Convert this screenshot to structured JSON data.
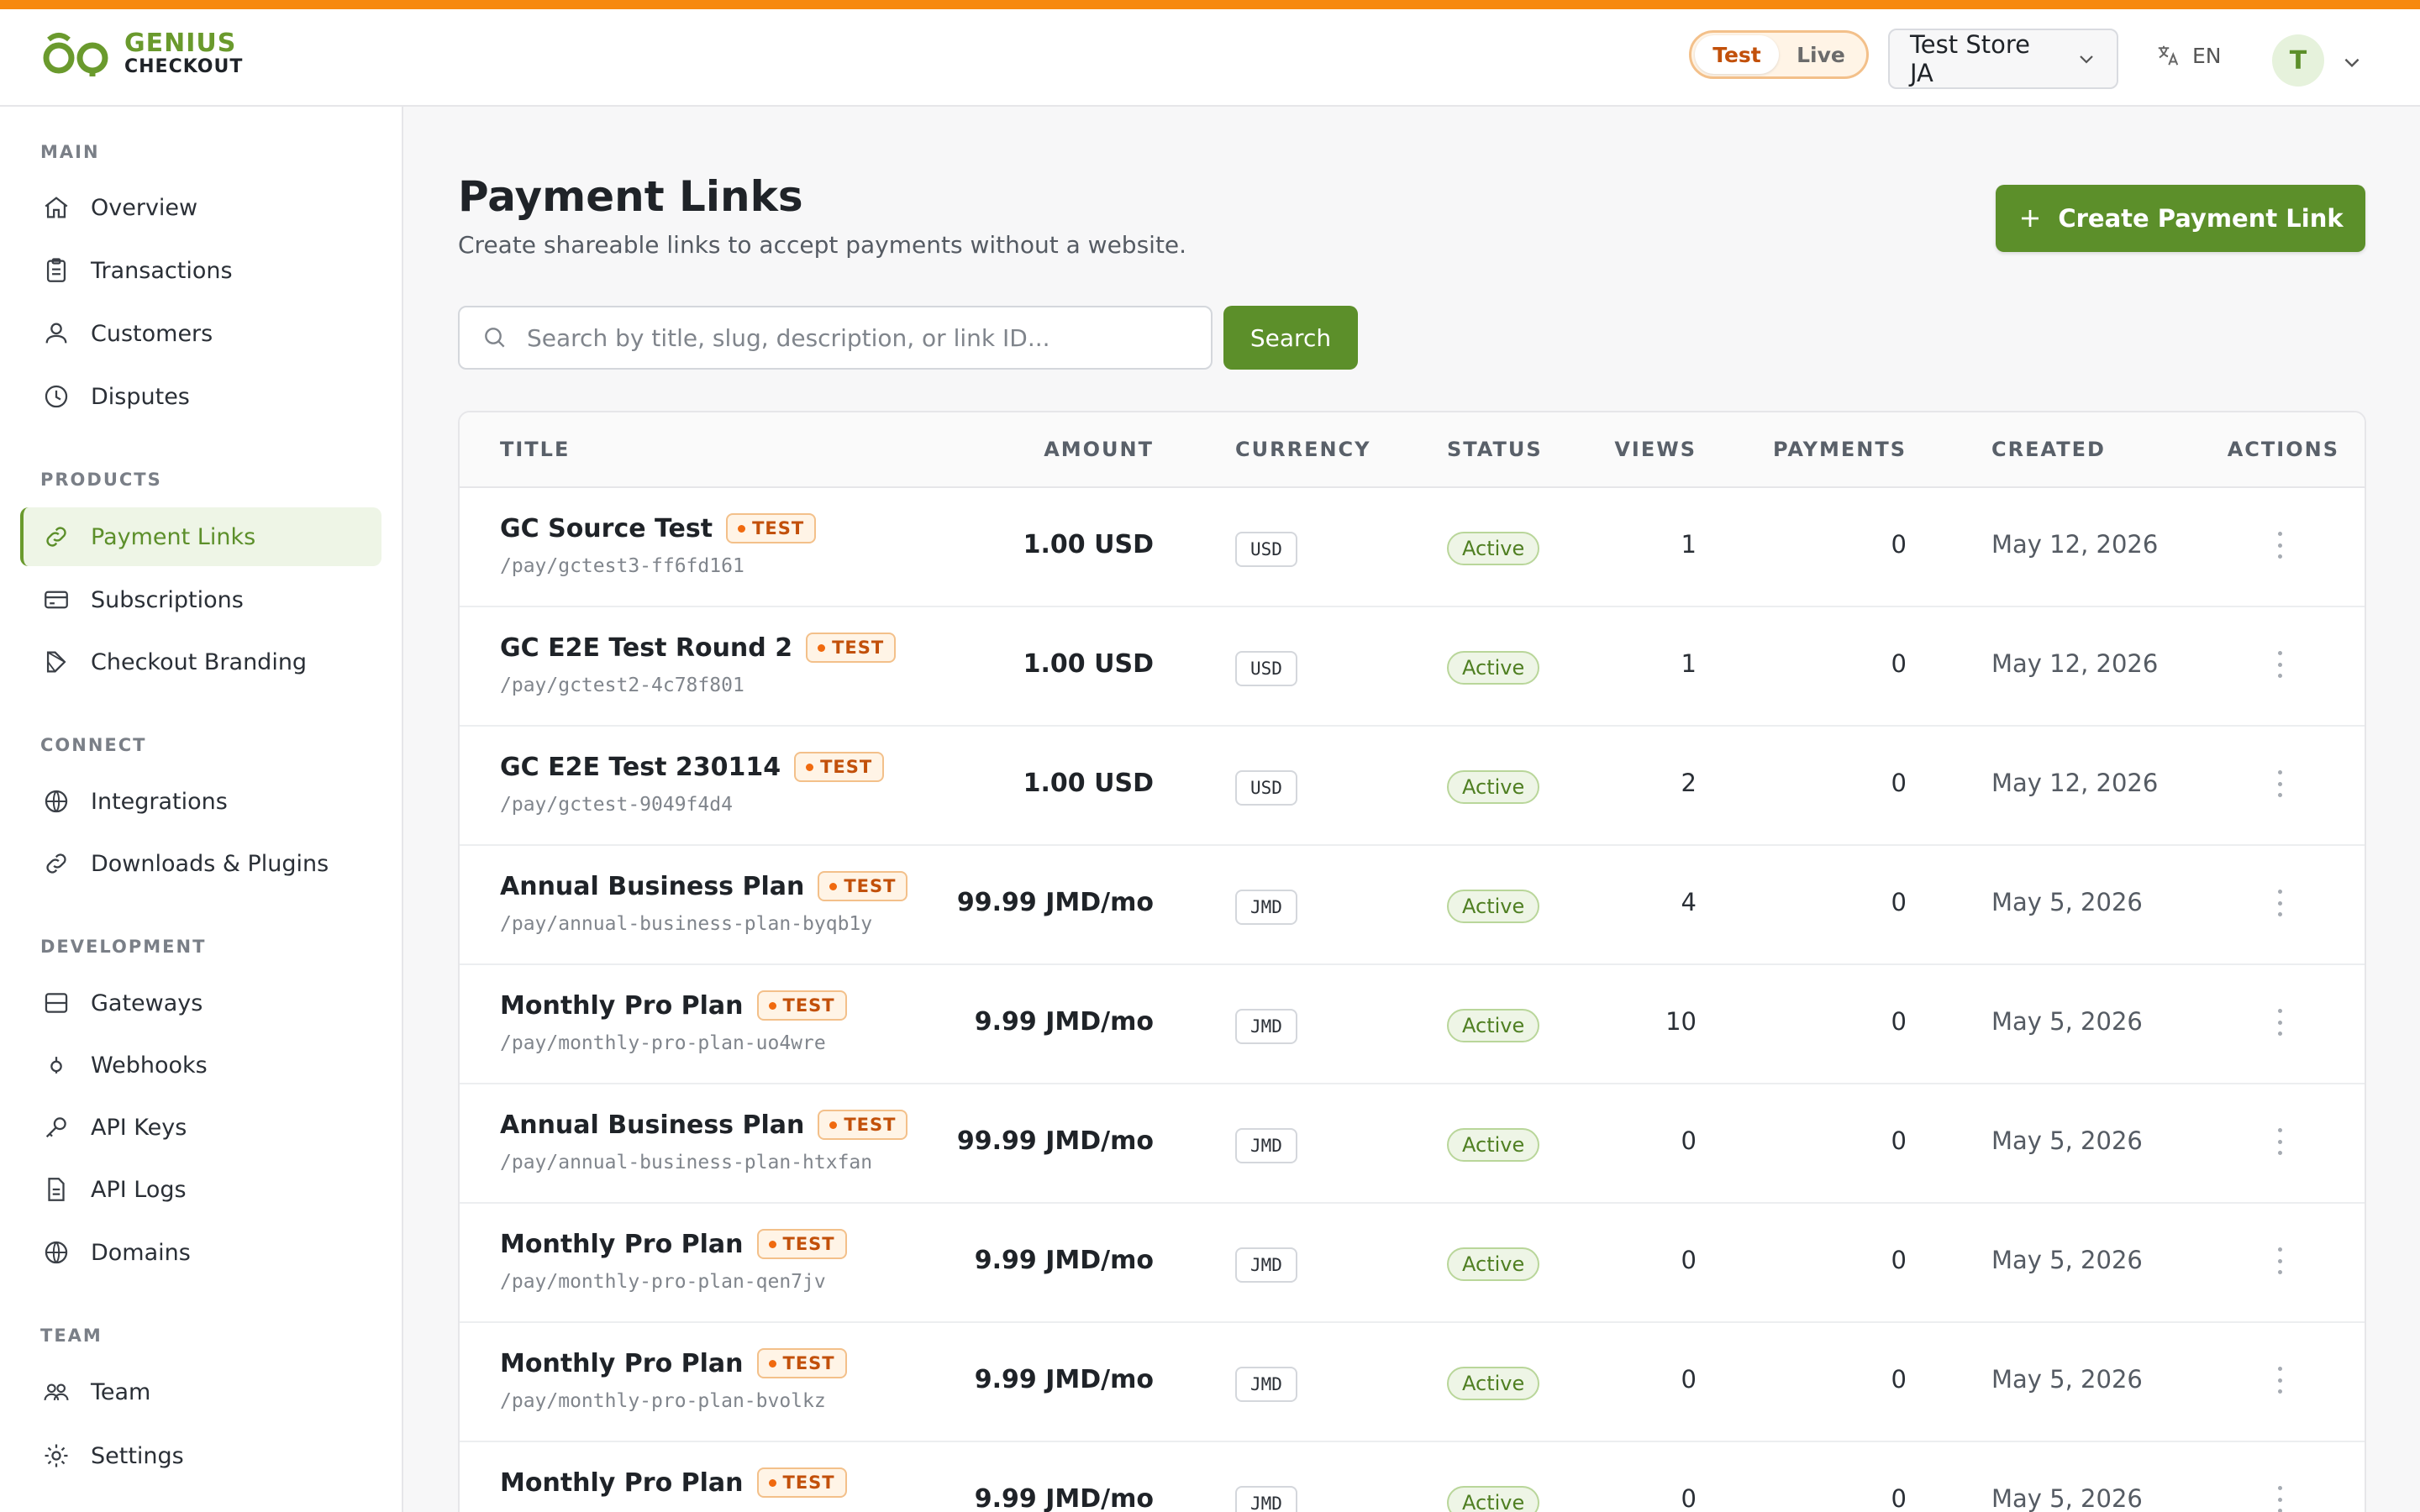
{
  "brand": {
    "line1": "GENIUS",
    "line2": "CHECKOUT",
    "accent": "#f7890f",
    "green": "#5c8f2a"
  },
  "topnav": {
    "mode_test": "Test",
    "mode_live": "Live",
    "store": "Test Store JA",
    "lang": "EN",
    "avatar": "T"
  },
  "sidebar": {
    "sections": [
      {
        "label": "MAIN",
        "items": [
          {
            "label": "Overview",
            "icon": "home-icon"
          },
          {
            "label": "Transactions",
            "icon": "clipboard-icon"
          },
          {
            "label": "Customers",
            "icon": "users-icon"
          },
          {
            "label": "Disputes",
            "icon": "clock-icon"
          }
        ]
      },
      {
        "label": "PRODUCTS",
        "items": [
          {
            "label": "Payment Links",
            "icon": "link-icon",
            "active": true
          },
          {
            "label": "Subscriptions",
            "icon": "credit-card-icon"
          },
          {
            "label": "Checkout Branding",
            "icon": "palette-icon"
          }
        ]
      },
      {
        "label": "CONNECT",
        "items": [
          {
            "label": "Integrations",
            "icon": "globe-icon"
          },
          {
            "label": "Downloads & Plugins",
            "icon": "link-icon"
          }
        ]
      },
      {
        "label": "DEVELOPMENT",
        "items": [
          {
            "label": "Gateways",
            "icon": "server-icon"
          },
          {
            "label": "Webhooks",
            "icon": "webhook-icon"
          },
          {
            "label": "API Keys",
            "icon": "key-icon"
          },
          {
            "label": "API Logs",
            "icon": "file-icon"
          },
          {
            "label": "Domains",
            "icon": "globe-icon"
          }
        ]
      },
      {
        "label": "TEAM",
        "items": [
          {
            "label": "Team",
            "icon": "team-icon"
          },
          {
            "label": "Settings",
            "icon": "gear-icon"
          }
        ]
      }
    ]
  },
  "page": {
    "title": "Payment Links",
    "subtitle": "Create shareable links to accept payments without a website.",
    "create_label": "Create Payment Link",
    "search_placeholder": "Search by title, slug, description, or link ID...",
    "search_label": "Search"
  },
  "table": {
    "headers": {
      "title": "TITLE",
      "amount": "AMOUNT",
      "currency": "CURRENCY",
      "status": "STATUS",
      "views": "VIEWS",
      "payments": "PAYMENTS",
      "created": "CREATED",
      "actions": "ACTIONS"
    },
    "badge_test": "TEST",
    "rows": [
      {
        "title": "GC Source Test",
        "slug": "/pay/gctest3-ff6fd161",
        "amount": "1.00 USD",
        "currency": "USD",
        "status": "Active",
        "views": "1",
        "payments": "0",
        "created": "May 12, 2026"
      },
      {
        "title": "GC E2E Test Round 2",
        "slug": "/pay/gctest2-4c78f801",
        "amount": "1.00 USD",
        "currency": "USD",
        "status": "Active",
        "views": "1",
        "payments": "0",
        "created": "May 12, 2026"
      },
      {
        "title": "GC E2E Test 230114",
        "slug": "/pay/gctest-9049f4d4",
        "amount": "1.00 USD",
        "currency": "USD",
        "status": "Active",
        "views": "2",
        "payments": "0",
        "created": "May 12, 2026"
      },
      {
        "title": "Annual Business Plan",
        "slug": "/pay/annual-business-plan-byqb1y",
        "amount": "99.99 JMD/mo",
        "currency": "JMD",
        "status": "Active",
        "views": "4",
        "payments": "0",
        "created": "May 5, 2026"
      },
      {
        "title": "Monthly Pro Plan",
        "slug": "/pay/monthly-pro-plan-uo4wre",
        "amount": "9.99 JMD/mo",
        "currency": "JMD",
        "status": "Active",
        "views": "10",
        "payments": "0",
        "created": "May 5, 2026"
      },
      {
        "title": "Annual Business Plan",
        "slug": "/pay/annual-business-plan-htxfan",
        "amount": "99.99 JMD/mo",
        "currency": "JMD",
        "status": "Active",
        "views": "0",
        "payments": "0",
        "created": "May 5, 2026"
      },
      {
        "title": "Monthly Pro Plan",
        "slug": "/pay/monthly-pro-plan-qen7jv",
        "amount": "9.99 JMD/mo",
        "currency": "JMD",
        "status": "Active",
        "views": "0",
        "payments": "0",
        "created": "May 5, 2026"
      },
      {
        "title": "Monthly Pro Plan",
        "slug": "/pay/monthly-pro-plan-bvolkz",
        "amount": "9.99 JMD/mo",
        "currency": "JMD",
        "status": "Active",
        "views": "0",
        "payments": "0",
        "created": "May 5, 2026"
      },
      {
        "title": "Monthly Pro Plan",
        "slug": "",
        "amount": "9.99 JMD/mo",
        "currency": "JMD",
        "status": "Active",
        "views": "0",
        "payments": "0",
        "created": "May 5, 2026"
      }
    ]
  }
}
